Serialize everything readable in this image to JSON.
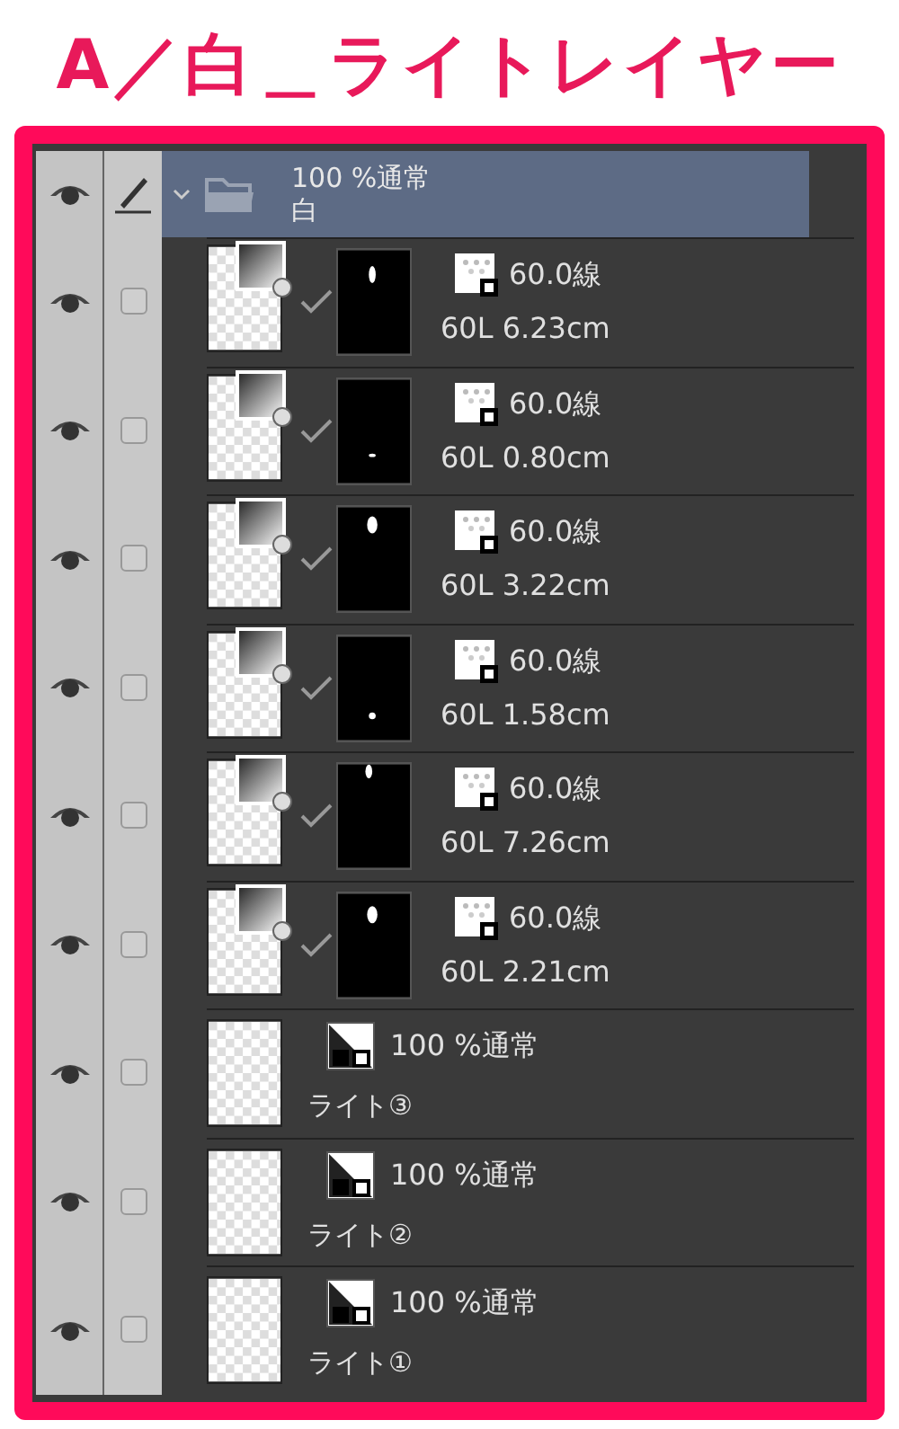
{
  "title": "A／白＿ライトレイヤー",
  "folder": {
    "expanded": true,
    "visible": true,
    "mode": "100 %通常",
    "name": "白"
  },
  "layers": [
    {
      "kind": "clip",
      "visible": true,
      "checked": false,
      "clipped": true,
      "line": "60.0線",
      "info": "60L 6.23cm"
    },
    {
      "kind": "clip",
      "visible": true,
      "checked": false,
      "clipped": true,
      "line": "60.0線",
      "info": "60L 0.80cm"
    },
    {
      "kind": "clip",
      "visible": true,
      "checked": false,
      "clipped": true,
      "line": "60.0線",
      "info": "60L 3.22cm"
    },
    {
      "kind": "clip",
      "visible": true,
      "checked": false,
      "clipped": true,
      "line": "60.0線",
      "info": "60L 1.58cm"
    },
    {
      "kind": "clip",
      "visible": true,
      "checked": false,
      "clipped": true,
      "line": "60.0線",
      "info": "60L 7.26cm"
    },
    {
      "kind": "clip",
      "visible": true,
      "checked": false,
      "clipped": true,
      "line": "60.0線",
      "info": "60L 2.21cm"
    },
    {
      "kind": "raster",
      "visible": true,
      "checked": false,
      "mode": "100 %通常",
      "name": "ライト③"
    },
    {
      "kind": "raster",
      "visible": true,
      "checked": false,
      "mode": "100 %通常",
      "name": "ライト②"
    },
    {
      "kind": "raster",
      "visible": true,
      "checked": false,
      "mode": "100 %通常",
      "name": "ライト①"
    }
  ]
}
